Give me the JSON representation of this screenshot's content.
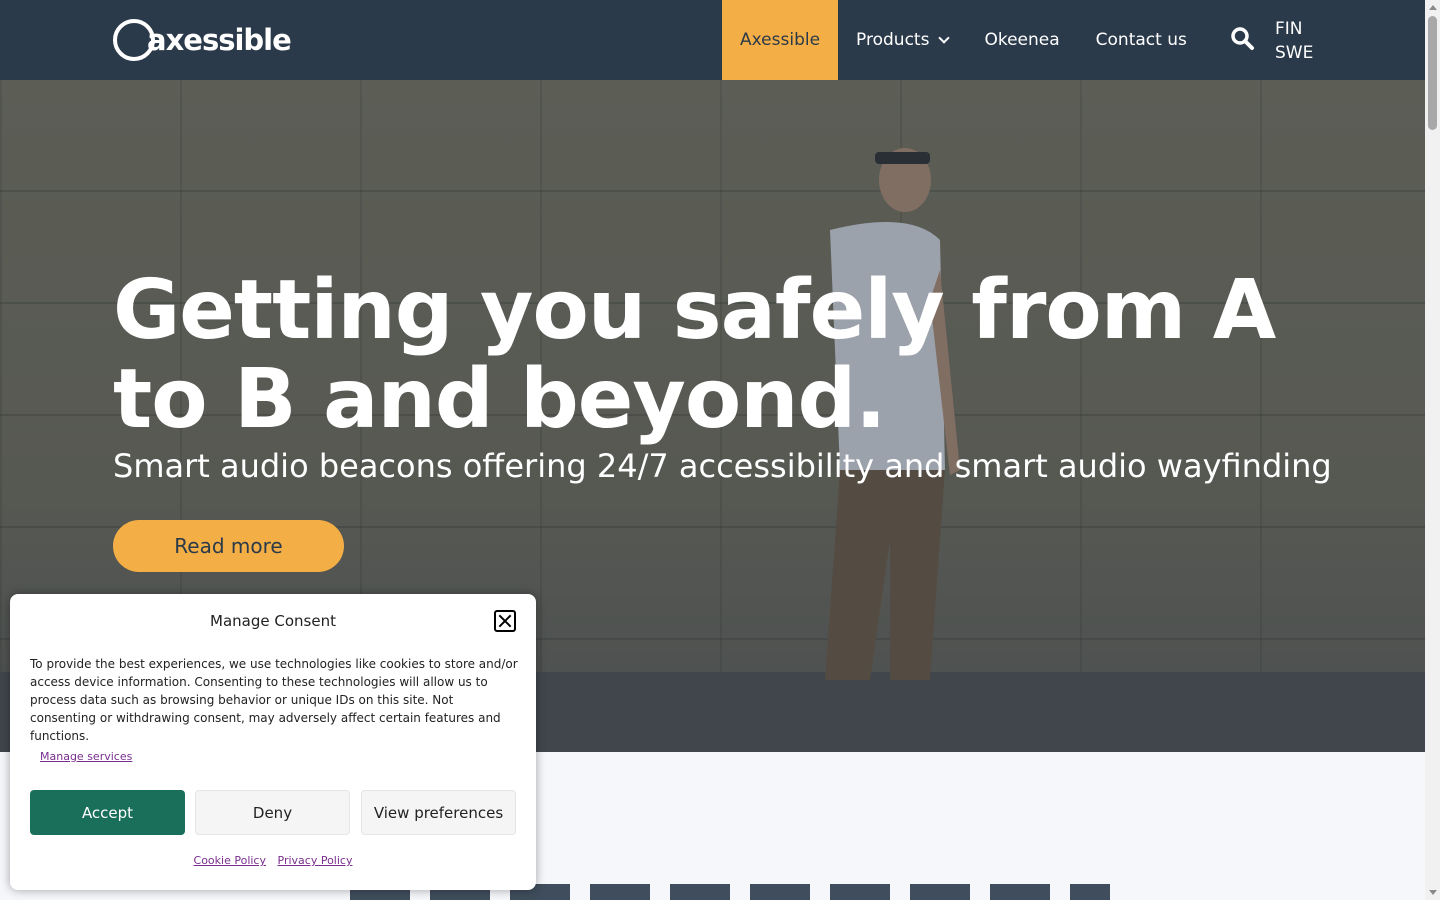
{
  "header": {
    "logo_text": "axessible",
    "nav": [
      {
        "label": "Axessible",
        "active": true
      },
      {
        "label": "Products",
        "dropdown": true
      },
      {
        "label": "Okeenea"
      },
      {
        "label": "Contact us"
      }
    ],
    "search_icon": "search-icon",
    "languages": [
      "FIN",
      "SWE"
    ]
  },
  "hero": {
    "title": "Getting you safely from A to B and beyond.",
    "subtitle": "Smart audio beacons offering 24/7 accessibility and smart audio wayfinding",
    "cta": "Read more"
  },
  "consent": {
    "title": "Manage Consent",
    "text": "To provide the best experiences, we use technologies like cookies to store and/or access device information. Consenting to these technologies will allow us to process data such as browsing behavior or unique IDs on this site. Not consenting or withdrawing consent, may adversely affect certain features and functions.",
    "manage_services": "Manage services",
    "accept": "Accept",
    "deny": "Deny",
    "view_preferences": "View preferences",
    "cookie_policy": "Cookie Policy",
    "privacy_policy": "Privacy Policy"
  },
  "colors": {
    "header_bg": "#2b3a4a",
    "accent": "#f3ae45",
    "accept_bg": "#1a6f5b",
    "link": "#7a2f8e"
  }
}
